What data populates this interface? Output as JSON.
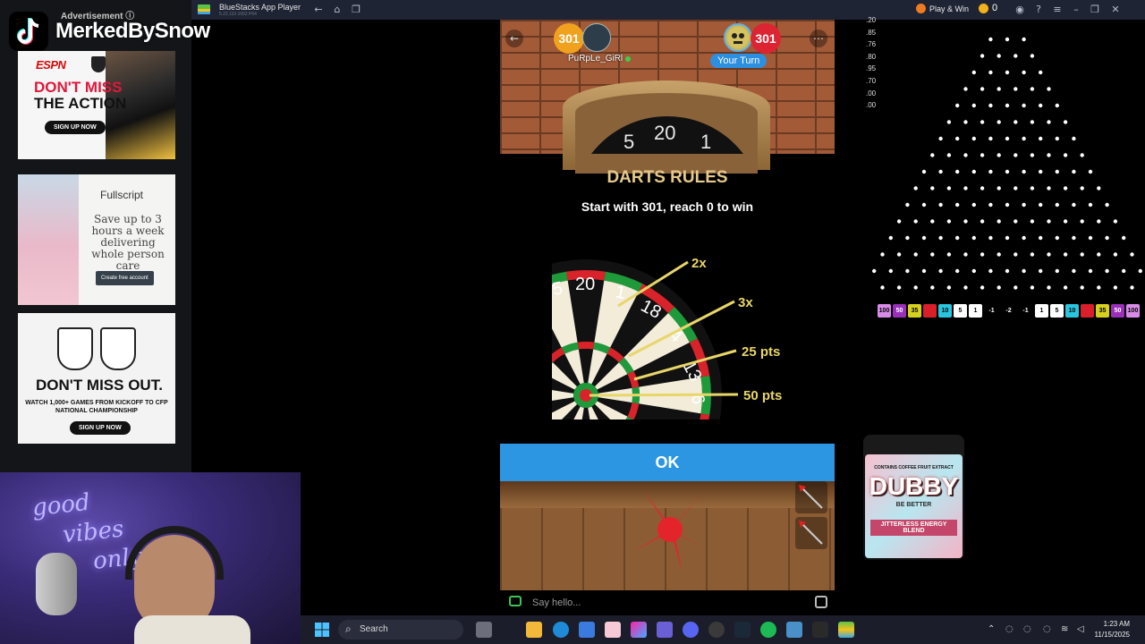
{
  "overlay": {
    "channel_name": "MerkedBySnow"
  },
  "ads": {
    "label": "Advertisement ⓘ",
    "espn_nhl": {
      "brand": "ESPN",
      "line1": "DON'T MISS",
      "line2": "THE ACTION",
      "button": "SIGN UP NOW"
    },
    "fullscript": {
      "brand": "Fullscript",
      "copy": "Save up to 3 hours a week delivering whole person care",
      "button": "Create free account"
    },
    "espn_cfp": {
      "headline": "DON'T MISS OUT.",
      "copy": "WATCH 1,000+ GAMES FROM KICKOFF TO CFP NATIONAL CHAMPIONSHIP",
      "button": "SIGN UP NOW"
    }
  },
  "window": {
    "title": "BlueStacks App Player",
    "subtitle": "5.22.110.1002 P64",
    "play_win": "Play & Win",
    "coins": "0"
  },
  "game": {
    "player1": {
      "score": "301",
      "name": "PuRpLe_GiRl"
    },
    "player2": {
      "score": "301",
      "turn_label": "Your Turn"
    },
    "board_numbers": [
      "5",
      "20",
      "1"
    ],
    "rules": {
      "title": "DARTS RULES",
      "subtitle": "Start with 301, reach 0 to win",
      "board_numbers": [
        "5",
        "20",
        "1",
        "18",
        "4",
        "13",
        "6"
      ],
      "callouts": [
        "2x",
        "3x",
        "25 pts",
        "50 pts"
      ],
      "callout_color": "#e8d66a"
    },
    "ok_label": "OK",
    "chat_placeholder": "Say hello..."
  },
  "plinko": {
    "odds": [
      ".20",
      ".85",
      ".76",
      ".80",
      ".95",
      ".70",
      ".00",
      ".00"
    ],
    "slots": [
      {
        "label": "100",
        "color": "#d98be8"
      },
      {
        "label": "50",
        "color": "#9a2fb8"
      },
      {
        "label": "35",
        "color": "#d6d11f"
      },
      {
        "label": "",
        "color": "#d91f2a"
      },
      {
        "label": "10",
        "color": "#29c4de"
      },
      {
        "label": "5",
        "color": "#ffffff"
      },
      {
        "label": "1",
        "color": "#ffffff"
      },
      {
        "label": "-1",
        "color": ""
      },
      {
        "label": "-2",
        "color": ""
      },
      {
        "label": "-1",
        "color": ""
      },
      {
        "label": "1",
        "color": "#ffffff"
      },
      {
        "label": "5",
        "color": "#ffffff"
      },
      {
        "label": "10",
        "color": "#29c4de"
      },
      {
        "label": "",
        "color": "#d91f2a"
      },
      {
        "label": "35",
        "color": "#d6d11f"
      },
      {
        "label": "50",
        "color": "#9a2fb8"
      },
      {
        "label": "100",
        "color": "#d98be8"
      }
    ]
  },
  "product": {
    "tag": "CONTAINS COFFEE FRUIT EXTRACT",
    "name": "DUBBY",
    "line": "BE BETTER",
    "desc": "JITTERLESS ENERGY BLEND"
  },
  "taskbar": {
    "search_label": "Search",
    "time": "1:23 AM",
    "date": "11/15/2025"
  }
}
